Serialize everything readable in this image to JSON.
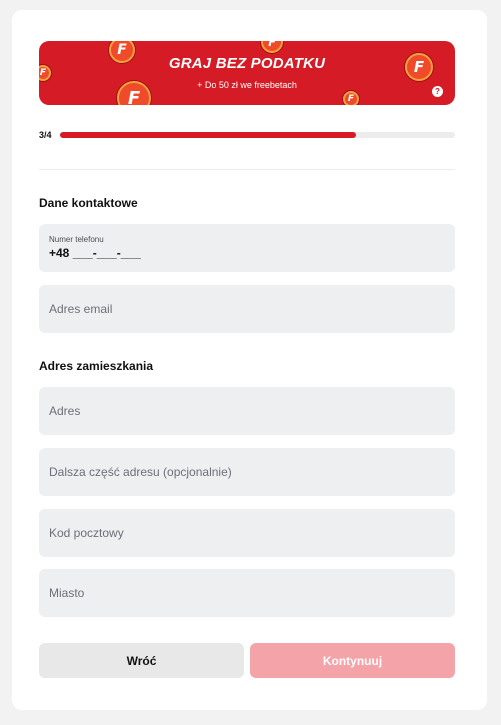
{
  "banner": {
    "title": "GRAJ BEZ PODATKU",
    "subtitle": "+ Do 50 zł we freebetach",
    "coin_letter": "F",
    "help": "?"
  },
  "progress": {
    "label": "3/4",
    "value": 0.75
  },
  "contact": {
    "title": "Dane kontaktowe",
    "phone_label": "Numer telefonu",
    "phone_value": "+48 ___-___-___",
    "email_placeholder": "Adres email"
  },
  "address": {
    "title": "Adres zamieszkania",
    "street_placeholder": "Adres",
    "street2_placeholder": "Dalsza część adresu (opcjonalnie)",
    "postal_placeholder": "Kod pocztowy",
    "city_placeholder": "Miasto"
  },
  "actions": {
    "back_label": "Wróć",
    "next_label": "Kontynuuj"
  },
  "colors": {
    "brand_red": "#d51b25",
    "disabled_button": "#f4a3a8",
    "field_bg": "#eeeff0"
  }
}
